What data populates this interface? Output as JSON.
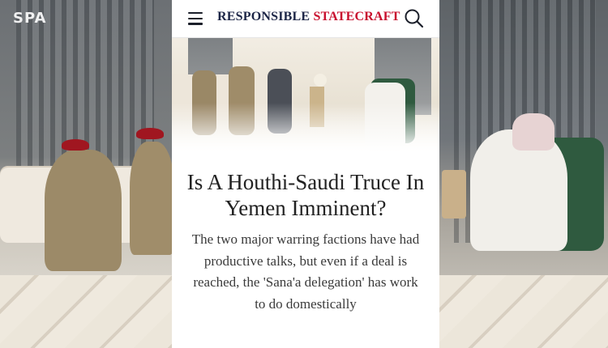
{
  "source_logo": {
    "text": "SPA"
  },
  "site": {
    "brand_part1": "RESPONSIBLE",
    "brand_part2": "STATECRAFT",
    "brand_colors": {
      "navy": "#1d2647",
      "red": "#c8102e"
    },
    "menu_icon": "hamburger-menu-icon",
    "search_icon": "search-icon"
  },
  "article": {
    "headline": "Is A Houthi-Saudi Truce In Yemen Imminent?",
    "summary": "The two major warring factions have had productive talks, but even if a deal is reached, the 'Sana'a delegation' has work to do domestically"
  }
}
